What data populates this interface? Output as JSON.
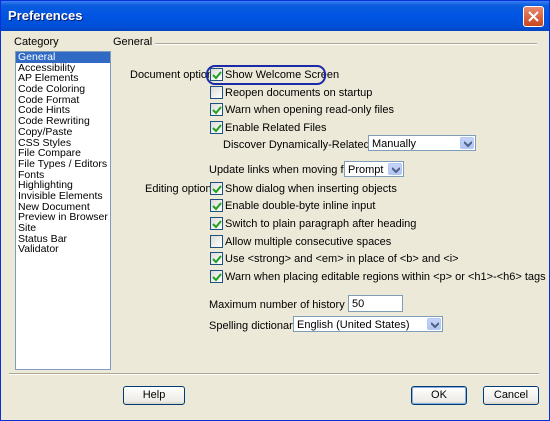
{
  "window": {
    "title": "Preferences"
  },
  "category": {
    "label": "Category",
    "items": [
      "General",
      "Accessibility",
      "AP Elements",
      "Code Coloring",
      "Code Format",
      "Code Hints",
      "Code Rewriting",
      "Copy/Paste",
      "CSS Styles",
      "File Compare",
      "File Types / Editors",
      "Fonts",
      "Highlighting",
      "Invisible Elements",
      "New Document",
      "Preview in Browser",
      "Site",
      "Status Bar",
      "Validator"
    ],
    "selected": "General"
  },
  "panel": {
    "heading": "General",
    "document_options_label": "Document options:",
    "editing_options_label": "Editing options:",
    "show_welcome": {
      "label": "Show Welcome Screen",
      "checked": true
    },
    "reopen_docs": {
      "label": "Reopen documents on startup",
      "checked": false
    },
    "warn_readonly": {
      "label": "Warn when opening read-only files",
      "checked": true
    },
    "related_files": {
      "label": "Enable Related Files",
      "checked": true
    },
    "discover_label": "Discover Dynamically-Related Files:",
    "discover_value": "Manually",
    "update_links_label": "Update links when moving files:",
    "update_links_value": "Prompt",
    "show_dialog": {
      "label": "Show dialog when inserting objects",
      "checked": true
    },
    "double_byte": {
      "label": "Enable double-byte inline input",
      "checked": true
    },
    "plain_paragraph": {
      "label": "Switch to plain paragraph after heading",
      "checked": true
    },
    "multiple_spaces": {
      "label": "Allow multiple consecutive spaces",
      "checked": false
    },
    "strong_em": {
      "label": "Use <strong> and <em> in place of <b> and <i>",
      "checked": true
    },
    "warn_editable": {
      "label": "Warn when placing editable regions within <p> or <h1>-<h6> tags",
      "checked": true
    },
    "history_label": "Maximum number of history steps:",
    "history_value": "50",
    "spelling_label": "Spelling dictionary:",
    "spelling_value": "English (United States)"
  },
  "buttons": {
    "help": "Help",
    "ok": "OK",
    "cancel": "Cancel"
  }
}
